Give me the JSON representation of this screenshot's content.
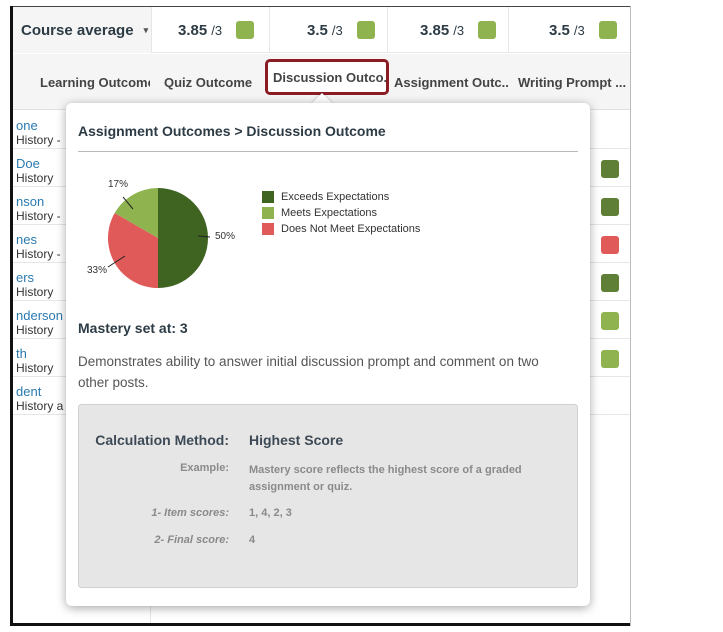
{
  "header": {
    "course_average_label": "Course average",
    "caret": "▾",
    "scores": [
      {
        "score": "3.85",
        "denominator": "/3",
        "color": "#8fb34f"
      },
      {
        "score": "3.5",
        "denominator": "/3",
        "color": "#8fb34f"
      },
      {
        "score": "3.85",
        "denominator": "/3",
        "color": "#8fb34f"
      },
      {
        "score": "3.5",
        "denominator": "/3",
        "color": "#8fb34f"
      }
    ]
  },
  "columns": [
    "Learning Outcome",
    "Quiz Outcome",
    "Discussion Outco...",
    "Assignment Outc...",
    "Writing Prompt ..."
  ],
  "students": [
    {
      "name": "one",
      "course": "History -"
    },
    {
      "name": "Doe",
      "course": "History"
    },
    {
      "name": "nson",
      "course": "History -"
    },
    {
      "name": "nes",
      "course": "History -"
    },
    {
      "name": "ers",
      "course": "History"
    },
    {
      "name": "nderson",
      "course": "History"
    },
    {
      "name": "th",
      "course": "History"
    },
    {
      "name": "dent",
      "course": "History a"
    }
  ],
  "row_indicators": [
    "dark",
    "dark",
    "red",
    "dark",
    "light",
    "light"
  ],
  "popover": {
    "title": "Assignment Outcomes > Discussion Outcome",
    "legend": [
      {
        "label": "Exceeds Expectations",
        "color": "#3f6320"
      },
      {
        "label": "Meets Expectations",
        "color": "#8fb34f"
      },
      {
        "label": "Does Not Meet Expectations",
        "color": "#e05a5a"
      }
    ],
    "pie_labels": {
      "exceeds": "50%",
      "meets": "17%",
      "not_meets": "33%"
    },
    "mastery": "Mastery set at: 3",
    "description": "Demonstrates ability to answer initial discussion prompt and comment on two other posts.",
    "calculation": {
      "method_label": "Calculation Method:",
      "method_value": "Highest Score",
      "example_label": "Example:",
      "example_value": "Mastery score reflects the highest score of a graded assignment or quiz.",
      "item_scores_label": "1- Item scores:",
      "item_scores_value": "1, 4, 2, 3",
      "final_score_label": "2- Final score:",
      "final_score_value": "4"
    }
  },
  "colors": {
    "accent_dark_green": "#3f6320",
    "light_green": "#8fb34f",
    "red": "#e05a5a",
    "active_border": "#8b1c24",
    "link_blue": "#2a7ab0"
  }
}
